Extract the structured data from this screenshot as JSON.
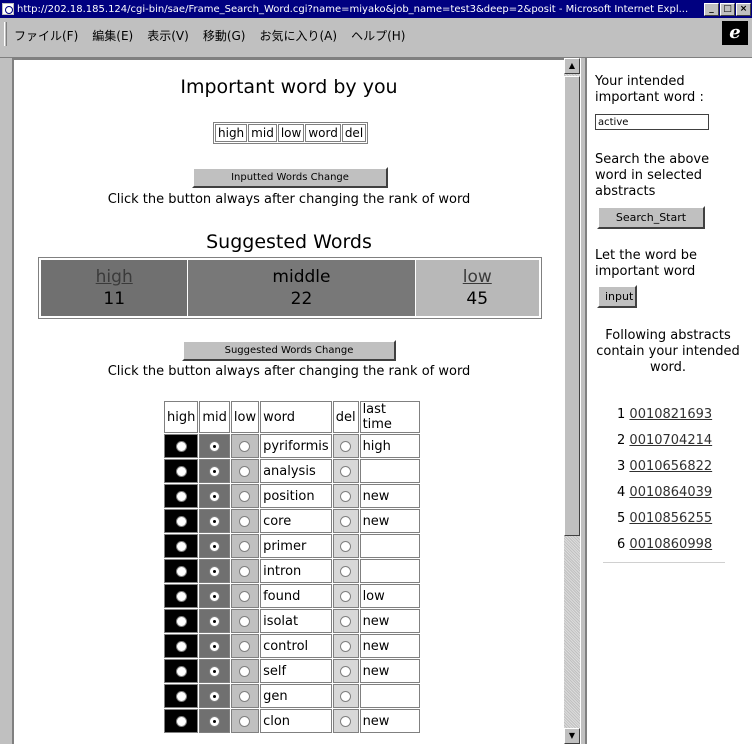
{
  "window": {
    "title": "http://202.18.185.124/cgi-bin/sae/Frame_Search_Word.cgi?name=miyako&job_name=test3&deep=2&posit - Microsoft Internet Expl..."
  },
  "menu": [
    "ファイル(F)",
    "編集(E)",
    "表示(V)",
    "移動(G)",
    "お気に入り(A)",
    "ヘルプ(H)"
  ],
  "main": {
    "important_heading": "Important word by you",
    "rank_headers": [
      "high",
      "mid",
      "low",
      "word",
      "del"
    ],
    "inputted_button": "Inputted Words Change",
    "note": "Click the button always after changing the rank of word",
    "suggested_heading": "Suggested Words",
    "suggested": {
      "high_label": "high",
      "high_count": "11",
      "middle_label": "middle",
      "middle_count": "22",
      "low_label": "low",
      "low_count": "45"
    },
    "suggested_button": "Suggested Words Change",
    "word_table": {
      "headers": [
        "high",
        "mid",
        "low",
        "word",
        "del",
        "last time"
      ],
      "rows": [
        {
          "word": "pyriformis",
          "last": "high"
        },
        {
          "word": "analysis",
          "last": ""
        },
        {
          "word": "position",
          "last": "new"
        },
        {
          "word": "core",
          "last": "new"
        },
        {
          "word": "primer",
          "last": ""
        },
        {
          "word": "intron",
          "last": ""
        },
        {
          "word": "found",
          "last": "low"
        },
        {
          "word": "isolat",
          "last": "new"
        },
        {
          "word": "control",
          "last": "new"
        },
        {
          "word": "self",
          "last": "new"
        },
        {
          "word": "gen",
          "last": ""
        },
        {
          "word": "clon",
          "last": "new"
        }
      ]
    }
  },
  "side": {
    "intended_label": "Your intended important word :",
    "intended_value": "active",
    "search_text": "Search the above word in selected abstracts",
    "search_button": "Search_Start",
    "let_text": "Let the word be important word",
    "input_button": "input",
    "following_text": "Following abstracts contain your intended word.",
    "abstracts": [
      {
        "num": "1",
        "id": "0010821693"
      },
      {
        "num": "2",
        "id": "0010704214"
      },
      {
        "num": "3",
        "id": "0010656822"
      },
      {
        "num": "4",
        "id": "0010864039"
      },
      {
        "num": "5",
        "id": "0010856255"
      },
      {
        "num": "6",
        "id": "0010860998"
      }
    ]
  }
}
